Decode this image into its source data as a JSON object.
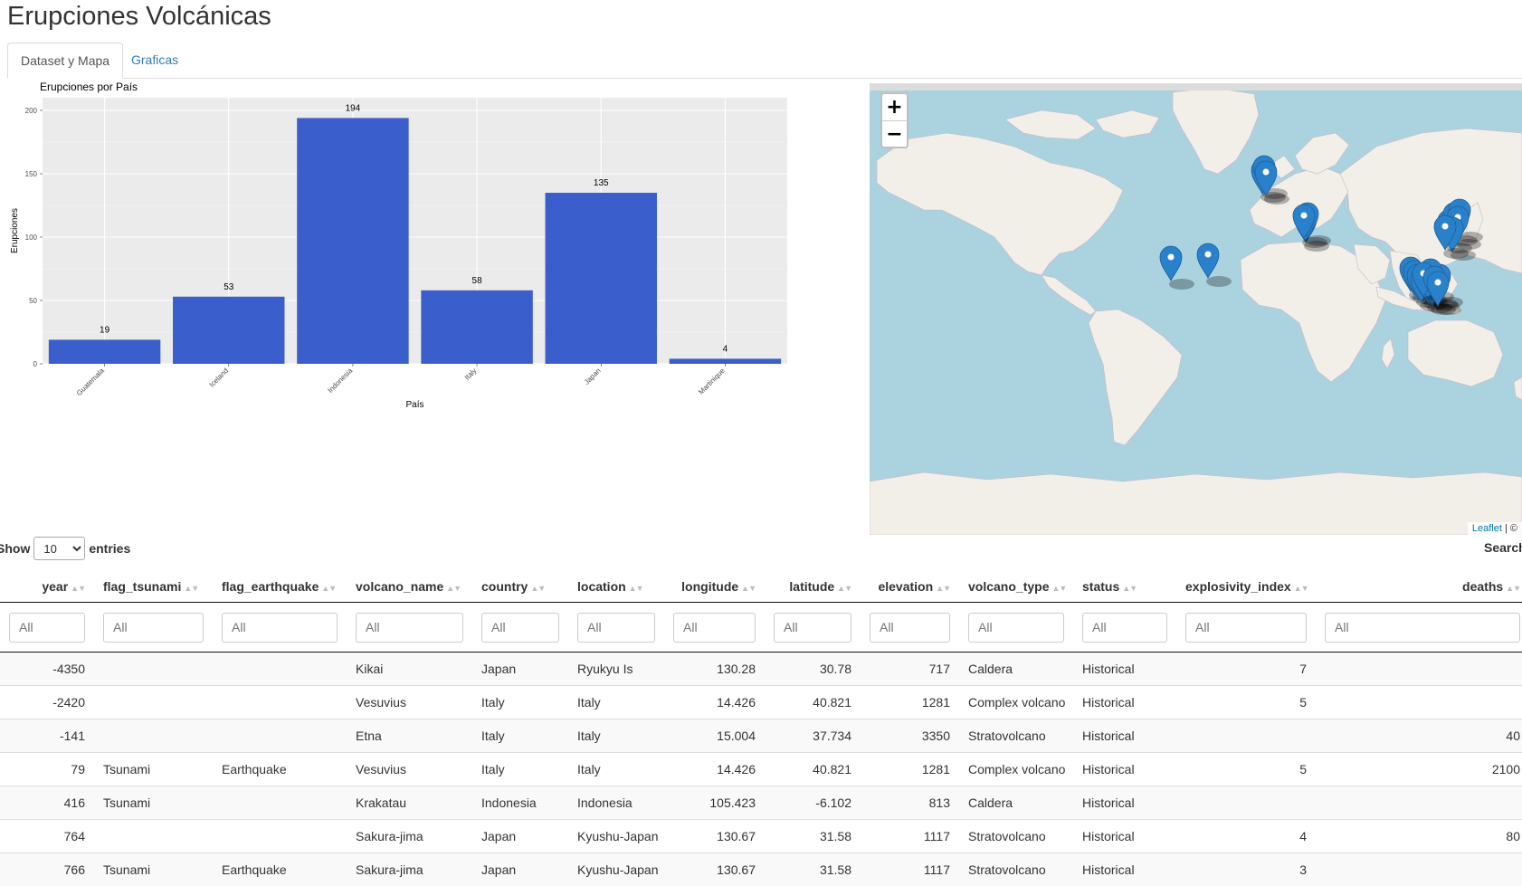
{
  "app": {
    "title": "Erupciones Volcánicas"
  },
  "tabs": [
    {
      "label": "Dataset y Mapa",
      "active": true
    },
    {
      "label": "Graficas",
      "active": false
    }
  ],
  "chart_data": {
    "type": "bar",
    "title": "Erupciones por País",
    "xlabel": "País",
    "ylabel": "Erupciones",
    "categories": [
      "Guatemala",
      "Iceland",
      "Indonesia",
      "Italy",
      "Japan",
      "Martinique"
    ],
    "values": [
      19,
      53,
      194,
      58,
      135,
      4
    ],
    "ylim": [
      0,
      200
    ],
    "yticks": [
      0,
      50,
      100,
      150,
      200
    ],
    "bar_color": "#3a5fcd",
    "panel_color": "#ebebeb",
    "grid": true,
    "legend": "none"
  },
  "map": {
    "zoom_in": "+",
    "zoom_out": "−",
    "attribution_link": "Leaflet",
    "attribution_rest": " | ©",
    "water_color": "#aad3df",
    "land_color": "#f2efe9",
    "marker_color": "#2a81cb"
  },
  "table": {
    "show_label": "Show",
    "entries_label": "entries",
    "page_length": "10",
    "search_label": "Search:",
    "filter_placeholder": "All",
    "columns": [
      "year",
      "flag_tsunami",
      "flag_earthquake",
      "volcano_name",
      "country",
      "location",
      "longitude",
      "latitude",
      "elevation",
      "volcano_type",
      "status",
      "explosivity_index",
      "deaths"
    ],
    "rows": [
      [
        "-4350",
        "",
        "",
        "Kikai",
        "Japan",
        "Ryukyu Is",
        "130.28",
        "30.78",
        "717",
        "Caldera",
        "Historical",
        "7",
        ""
      ],
      [
        "-2420",
        "",
        "",
        "Vesuvius",
        "Italy",
        "Italy",
        "14.426",
        "40.821",
        "1281",
        "Complex volcano",
        "Historical",
        "5",
        ""
      ],
      [
        "-141",
        "",
        "",
        "Etna",
        "Italy",
        "Italy",
        "15.004",
        "37.734",
        "3350",
        "Stratovolcano",
        "Historical",
        "",
        "40"
      ],
      [
        "79",
        "Tsunami",
        "Earthquake",
        "Vesuvius",
        "Italy",
        "Italy",
        "14.426",
        "40.821",
        "1281",
        "Complex volcano",
        "Historical",
        "5",
        "2100"
      ],
      [
        "416",
        "Tsunami",
        "",
        "Krakatau",
        "Indonesia",
        "Indonesia",
        "105.423",
        "-6.102",
        "813",
        "Caldera",
        "Historical",
        "",
        ""
      ],
      [
        "764",
        "",
        "",
        "Sakura-jima",
        "Japan",
        "Kyushu-Japan",
        "130.67",
        "31.58",
        "1117",
        "Stratovolcano",
        "Historical",
        "4",
        "80"
      ],
      [
        "766",
        "Tsunami",
        "Earthquake",
        "Sakura-jima",
        "Japan",
        "Kyushu-Japan",
        "130.67",
        "31.58",
        "1117",
        "Stratovolcano",
        "Historical",
        "3",
        ""
      ]
    ]
  }
}
